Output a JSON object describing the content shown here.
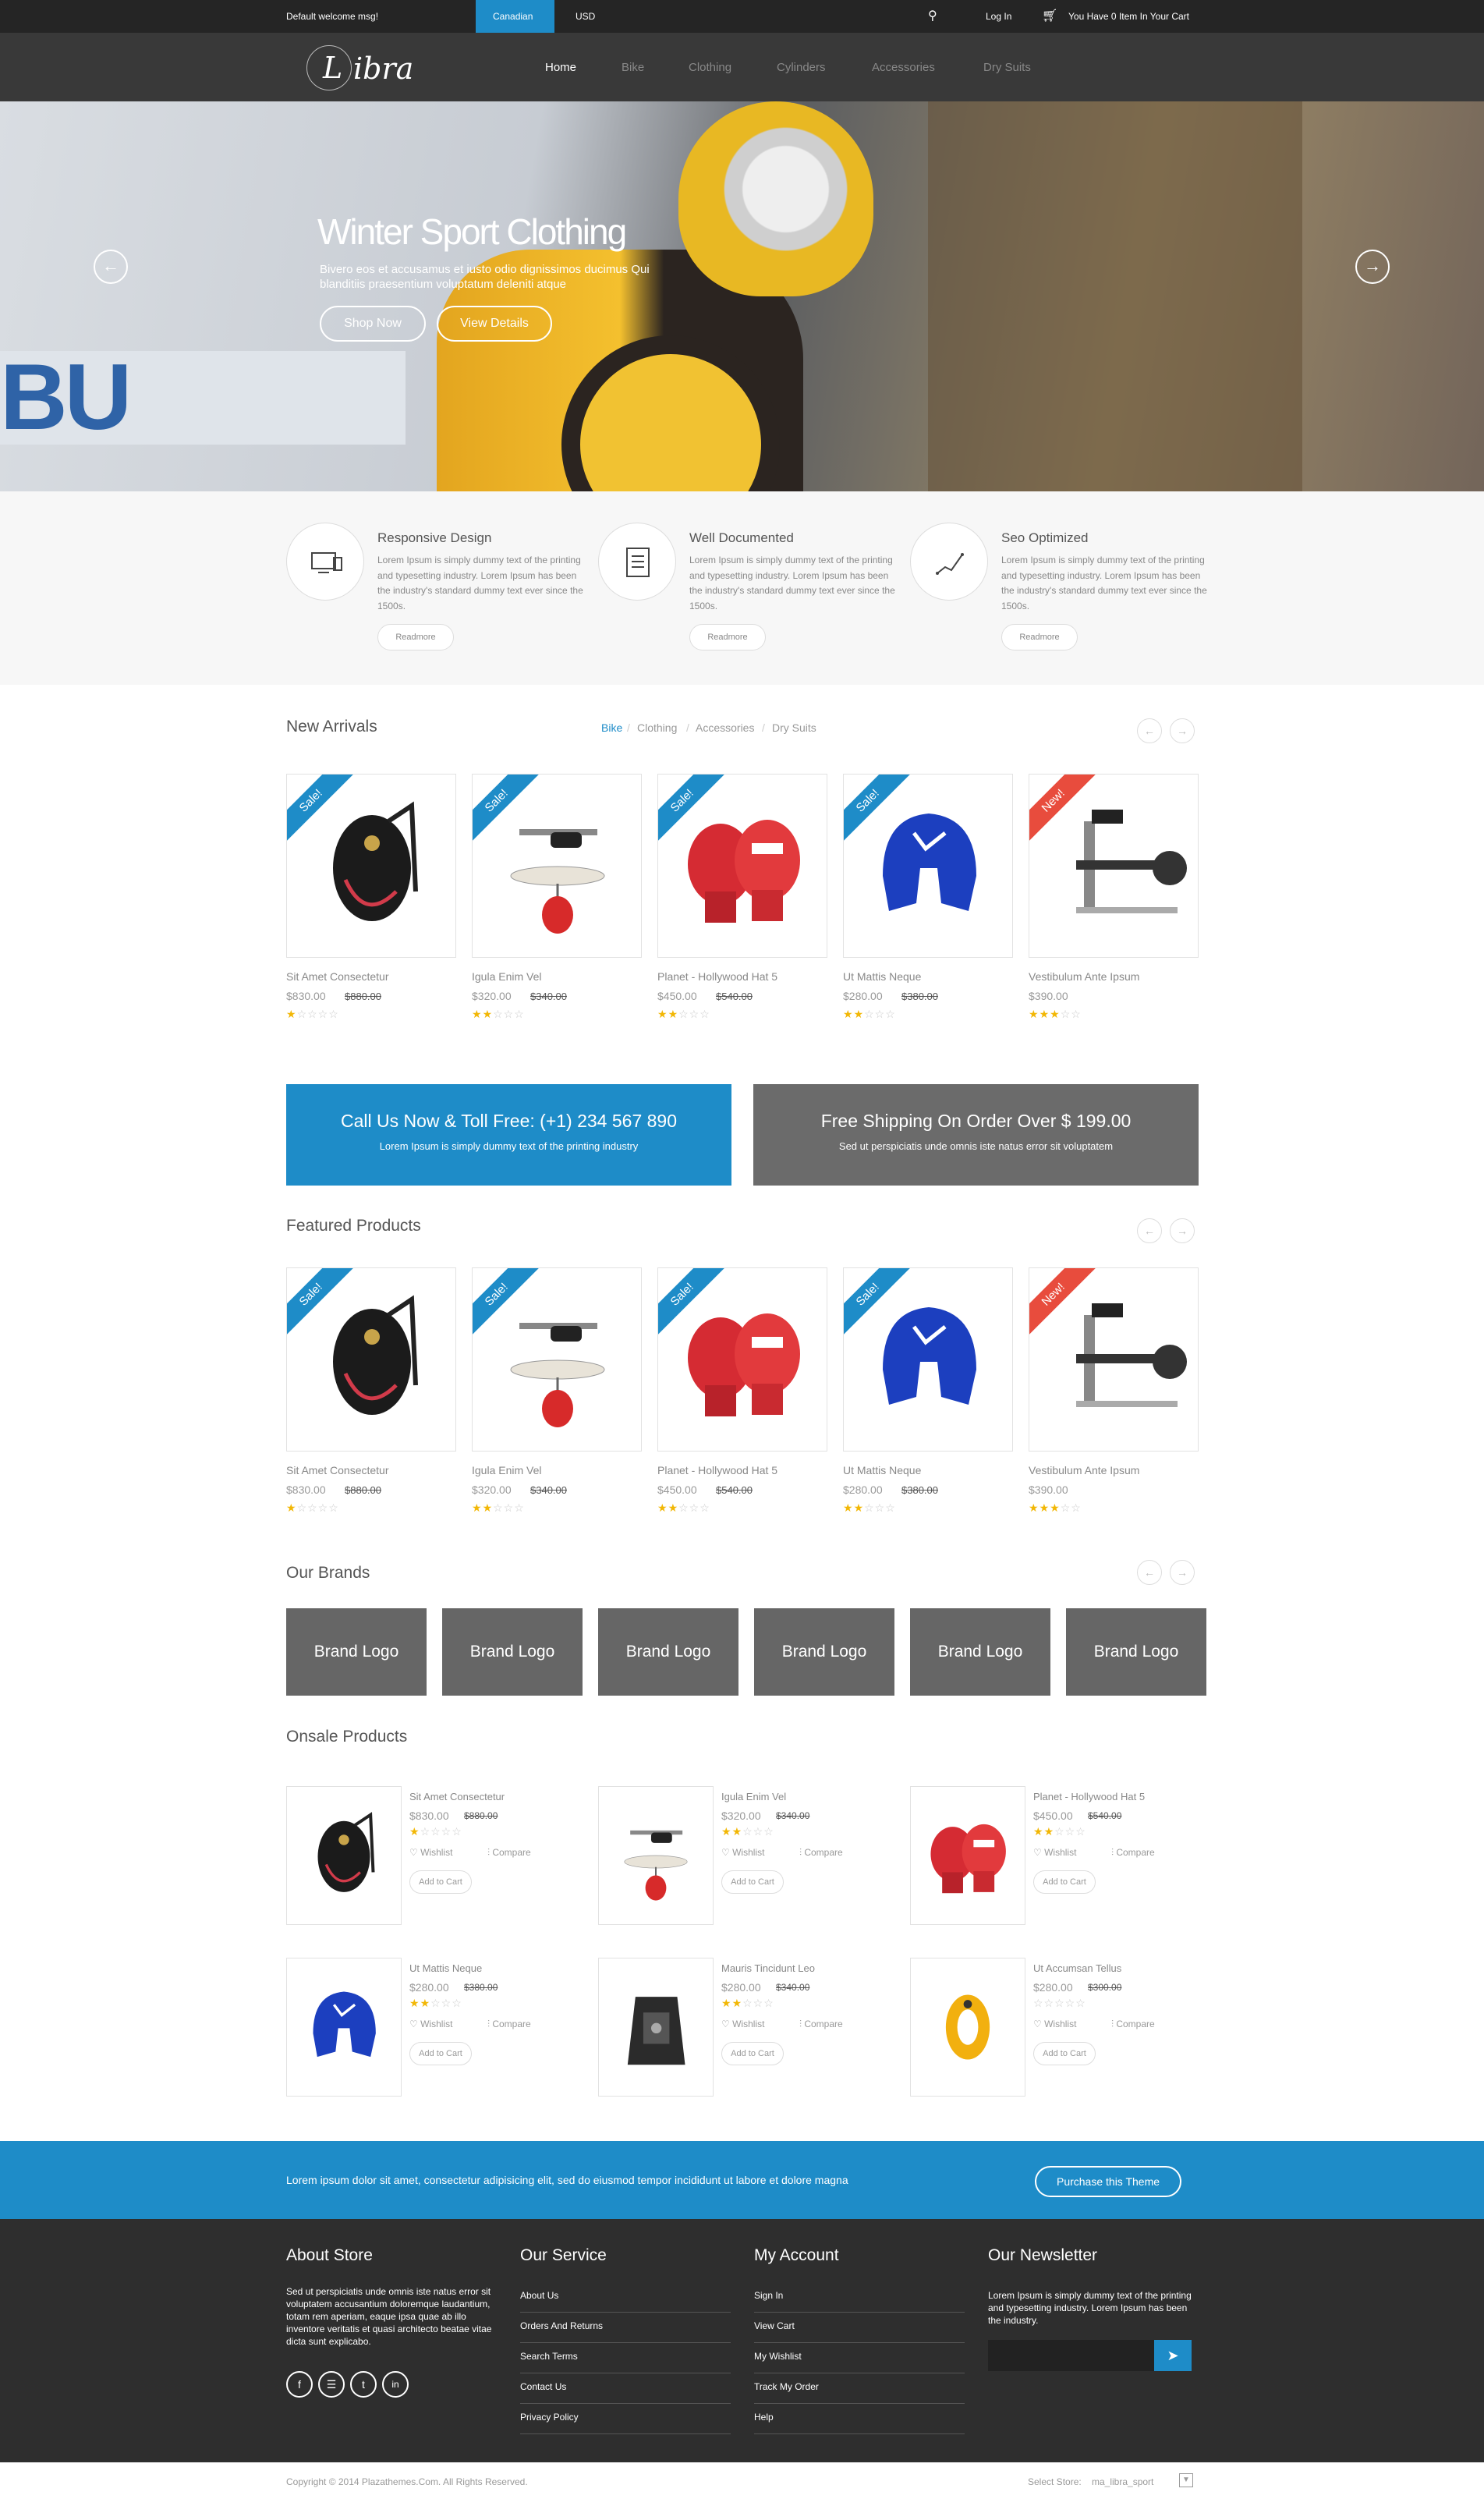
{
  "topbar": {
    "welcome": "Default welcome msg!",
    "currency_active": "Canadian",
    "currency_other": "USD",
    "login": "Log In",
    "cart": "You Have 0 Item In Your Cart"
  },
  "logo": {
    "letter": "L",
    "text": "ibra"
  },
  "nav": {
    "items": [
      "Home",
      "Bike",
      "Clothing",
      "Cylinders",
      "Accessories",
      "Dry Suits"
    ]
  },
  "hero": {
    "title": "Winter Sport Clothing",
    "subtitle": "Bivero eos et accusamus et iusto odio dignissimos ducimus Qui blanditiis praesentium voluptatum deleniti atque",
    "shop_now": "Shop Now",
    "view_details": "View Details",
    "banner_text": "BU",
    "prev": "←",
    "next": "→"
  },
  "features": [
    {
      "title": "Responsive Design",
      "text": "Lorem Ipsum is simply dummy text of the printing and typesetting industry. Lorem Ipsum has been the industry's standard dummy text ever since the 1500s.",
      "button": "Readmore",
      "icon": "devices-icon"
    },
    {
      "title": "Well Documented",
      "text": "Lorem Ipsum is simply dummy text of the printing and typesetting industry. Lorem Ipsum has been the industry's standard dummy text ever since the 1500s.",
      "button": "Readmore",
      "icon": "document-icon"
    },
    {
      "title": "Seo Optimized",
      "text": "Lorem Ipsum is simply dummy text of the printing and typesetting industry. Lorem Ipsum has been the industry's standard dummy text ever since the 1500s.",
      "button": "Readmore",
      "icon": "chart-icon"
    }
  ],
  "new_arrivals": {
    "title": "New Arrivals",
    "tabs": [
      "Bike",
      "Clothing",
      "Accessories",
      "Dry Suits"
    ],
    "tab_sep": "/",
    "prev": "←",
    "next": "→"
  },
  "products": [
    {
      "name": "Sit Amet Consectetur",
      "price": "$830.00",
      "old": "$880.00",
      "badge": "Sale!",
      "rating": 1,
      "image": "backpack"
    },
    {
      "name": "Igula Enim Vel",
      "price": "$320.00",
      "old": "$340.00",
      "badge": "Sale!",
      "rating": 2,
      "image": "punching-bag"
    },
    {
      "name": "Planet - Hollywood Hat 5",
      "price": "$450.00",
      "old": "$540.00",
      "badge": "Sale!",
      "rating": 2,
      "image": "boxing-gloves"
    },
    {
      "name": "Ut Mattis Neque",
      "price": "$280.00",
      "old": "$380.00",
      "badge": "Sale!",
      "rating": 2,
      "image": "headgear"
    },
    {
      "name": "Vestibulum Ante Ipsum",
      "price": "$390.00",
      "old": "",
      "badge": "New!",
      "rating": 3,
      "image": "gym-machine"
    }
  ],
  "banners": [
    {
      "title": "Call Us Now & Toll Free: (+1) 234 567 890",
      "sub": "Lorem Ipsum is simply dummy text of the printing industry",
      "color": "#1e8cc8"
    },
    {
      "title": "Free Shipping On Order Over $ 199.00",
      "sub": "Sed ut perspiciatis unde omnis iste natus error sit voluptatem",
      "color": "#6b6b6b"
    }
  ],
  "featured": {
    "title": "Featured Products",
    "prev": "←",
    "next": "→"
  },
  "brands": {
    "title": "Our Brands",
    "label": "Brand Logo",
    "count": 6,
    "prev": "←",
    "next": "→"
  },
  "onsale": {
    "title": "Onsale Products",
    "wishlist": "Wishlist",
    "compare": "Compare",
    "add_to_cart": "Add to Cart",
    "items": [
      {
        "name": "Sit Amet Consectetur",
        "price": "$830.00",
        "old": "$880.00",
        "rating": 1,
        "image": "backpack"
      },
      {
        "name": "Igula Enim Vel",
        "price": "$320.00",
        "old": "$340.00",
        "rating": 2,
        "image": "punching-bag"
      },
      {
        "name": "Planet - Hollywood Hat 5",
        "price": "$450.00",
        "old": "$540.00",
        "rating": 2,
        "image": "boxing-gloves"
      },
      {
        "name": "Ut Mattis Neque",
        "price": "$280.00",
        "old": "$380.00",
        "rating": 2,
        "image": "headgear"
      },
      {
        "name": "Mauris Tincidunt Leo",
        "price": "$280.00",
        "old": "$340.00",
        "rating": 2,
        "image": "buoyancy-vest"
      },
      {
        "name": "Ut Accumsan Tellus",
        "price": "$280.00",
        "old": "$300.00",
        "rating": 0,
        "image": "belay-device"
      }
    ]
  },
  "cta": {
    "text": "Lorem ipsum dolor sit amet, consectetur adipisicing elit, sed do eiusmod tempor incididunt ut labore et dolore magna",
    "button": "Purchase this Theme"
  },
  "footer": {
    "about": {
      "title": "About Store",
      "text": "Sed ut perspiciatis unde omnis iste natus error sit voluptatem accusantium doloremque laudantium, totam rem aperiam, eaque ipsa quae ab illo inventore veritatis et quasi architecto beatae vitae dicta sunt explicabo."
    },
    "service": {
      "title": "Our Service",
      "links": [
        "About Us",
        "Orders And Returns",
        "Search Terms",
        "Contact Us",
        "Privacy Policy"
      ]
    },
    "account": {
      "title": "My Account",
      "links": [
        "Sign In",
        "View Cart",
        "My Wishlist",
        "Track My Order",
        "Help"
      ]
    },
    "newsletter": {
      "title": "Our Newsletter",
      "text": "Lorem Ipsum is simply dummy text of the printing and typesetting industry. Lorem Ipsum has been the industry.",
      "placeholder": ""
    },
    "social": [
      {
        "glyph": "f",
        "icon": "facebook-icon"
      },
      {
        "glyph": "☰",
        "icon": "rss-icon"
      },
      {
        "glyph": "t",
        "icon": "twitter-icon"
      },
      {
        "glyph": "in",
        "icon": "linkedin-icon"
      }
    ]
  },
  "bottom": {
    "copyright": "Copyright © 2014 Plazathemes.Com. All Rights Reserved.",
    "select_label": "Select Store:",
    "store": "ma_libra_sport"
  },
  "colors": {
    "accent": "#1e8cc8",
    "sale": "#1e8cc8",
    "new": "#e84c3d",
    "dark": "#2e2e2e",
    "brand_box": "#666666"
  }
}
